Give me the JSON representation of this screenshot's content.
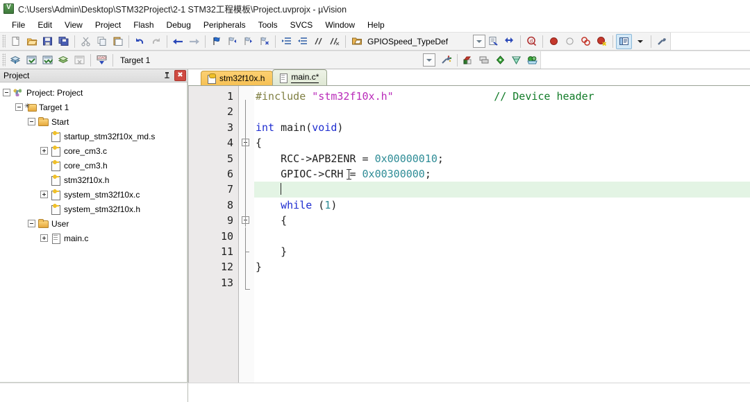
{
  "window": {
    "icon": "uvision-app-icon",
    "title": "C:\\Users\\Admin\\Desktop\\STM32Project\\2-1 STM32工程模板\\Project.uvprojx - µVision"
  },
  "menu": {
    "items": [
      {
        "label": "File"
      },
      {
        "label": "Edit"
      },
      {
        "label": "View"
      },
      {
        "label": "Project"
      },
      {
        "label": "Flash"
      },
      {
        "label": "Debug"
      },
      {
        "label": "Peripherals"
      },
      {
        "label": "Tools"
      },
      {
        "label": "SVCS"
      },
      {
        "label": "Window"
      },
      {
        "label": "Help"
      }
    ]
  },
  "toolbar_main": {
    "buttons": [
      {
        "name": "new-file-icon",
        "glyph": "⬜"
      },
      {
        "name": "open-file-icon",
        "glyph": "📂"
      },
      {
        "name": "save-icon",
        "glyph": "💾"
      },
      {
        "name": "save-all-icon",
        "glyph": "🖫"
      },
      {
        "name": "cut-icon",
        "glyph": "✀"
      },
      {
        "name": "copy-icon",
        "glyph": "⧉"
      },
      {
        "name": "paste-icon",
        "glyph": "📋"
      },
      {
        "name": "undo-icon",
        "glyph": "↶"
      },
      {
        "name": "redo-icon",
        "glyph": "↷"
      },
      {
        "name": "navigate-backward-icon",
        "glyph": "←"
      },
      {
        "name": "navigate-forward-icon",
        "glyph": "→"
      },
      {
        "name": "insert-bookmark-icon",
        "glyph": "⚑"
      },
      {
        "name": "previous-bookmark-icon",
        "glyph": "⚑"
      },
      {
        "name": "next-bookmark-icon",
        "glyph": "⚑"
      },
      {
        "name": "clear-bookmarks-icon",
        "glyph": "⚑"
      },
      {
        "name": "indent-icon",
        "glyph": "→|"
      },
      {
        "name": "outdent-icon",
        "glyph": "|←"
      },
      {
        "name": "comment-selection-icon",
        "glyph": "//"
      },
      {
        "name": "uncomment-selection-icon",
        "glyph": "//"
      },
      {
        "name": "open-project-icon",
        "glyph": "📁"
      }
    ],
    "find_combo": {
      "value": "GPIOSpeed_TypeDef",
      "placeholder": "GPIOSpeed_TypeDef"
    },
    "buttons_right": [
      {
        "name": "find-in-files-icon",
        "glyph": "🗋"
      },
      {
        "name": "goto-definition-icon",
        "glyph": "🔗"
      },
      {
        "name": "debug-session-icon",
        "glyph": "ⓘ"
      },
      {
        "name": "insert-breakpoint-icon",
        "glyph": "●"
      },
      {
        "name": "disable-breakpoint-icon",
        "glyph": "○"
      },
      {
        "name": "disable-all-breakpoints-icon",
        "glyph": "⬣"
      },
      {
        "name": "kill-all-breakpoints-icon",
        "glyph": "⬤"
      },
      {
        "name": "project-window-icon",
        "glyph": "▤"
      },
      {
        "name": "project-window-dropdown-icon",
        "glyph": "▾"
      },
      {
        "name": "configure-icon",
        "glyph": "🔧"
      }
    ]
  },
  "toolbar_build": {
    "buttons": [
      {
        "name": "translate-file-icon",
        "glyph": "◈"
      },
      {
        "name": "build-target-icon",
        "glyph": "☷"
      },
      {
        "name": "rebuild-all-icon",
        "glyph": "☸"
      },
      {
        "name": "batch-build-icon",
        "glyph": "◉"
      },
      {
        "name": "stop-build-icon",
        "glyph": "⌧"
      },
      {
        "name": "download-icon",
        "glyph": "⬇"
      }
    ],
    "target_label": "Target 1",
    "target_combo_value": "Target 1",
    "buttons_right": [
      {
        "name": "manage-project-items-icon",
        "glyph": "◰"
      },
      {
        "name": "select-software-packs-icon",
        "glyph": "❐"
      },
      {
        "name": "pack-installer-icon",
        "glyph": "◆"
      },
      {
        "name": "manage-run-time-env-icon",
        "glyph": "◇"
      },
      {
        "name": "multi-project-icon",
        "glyph": "⬢"
      }
    ]
  },
  "project_panel": {
    "caption": "Project",
    "pin_label": "⚑",
    "close_label": "✖",
    "tree": [
      {
        "label": "Project: Project",
        "indent": 0,
        "expander": "minus",
        "icon": "project-icon"
      },
      {
        "label": "Target 1",
        "indent": 1,
        "expander": "minus",
        "icon": "target-folder-icon"
      },
      {
        "label": "Start",
        "indent": 2,
        "expander": "minus",
        "icon": "folder-icon"
      },
      {
        "label": "startup_stm32f10x_md.s",
        "indent": 3,
        "expander": "none",
        "icon": "source-file-key-icon"
      },
      {
        "label": "core_cm3.c",
        "indent": 3,
        "expander": "plus",
        "icon": "source-file-key-icon"
      },
      {
        "label": "core_cm3.h",
        "indent": 3,
        "expander": "none",
        "icon": "source-file-key-icon"
      },
      {
        "label": "stm32f10x.h",
        "indent": 3,
        "expander": "none",
        "icon": "source-file-key-icon"
      },
      {
        "label": "system_stm32f10x.c",
        "indent": 3,
        "expander": "plus",
        "icon": "source-file-key-icon"
      },
      {
        "label": "system_stm32f10x.h",
        "indent": 3,
        "expander": "none",
        "icon": "source-file-key-icon"
      },
      {
        "label": "User",
        "indent": 2,
        "expander": "minus",
        "icon": "folder-icon"
      },
      {
        "label": "main.c",
        "indent": 3,
        "expander": "plus",
        "icon": "source-file-icon"
      }
    ]
  },
  "editor": {
    "tabs": [
      {
        "label": "stm32f10x.h",
        "active": false,
        "icon": "source-file-key-icon"
      },
      {
        "label": "main.c*",
        "active": true,
        "icon": "source-file-icon"
      }
    ],
    "line_numbers": [
      "1",
      "2",
      "3",
      "4",
      "5",
      "6",
      "7",
      "8",
      "9",
      "10",
      "11",
      "12",
      "13"
    ],
    "current_line": 7,
    "code_lines": [
      {
        "n": 1,
        "text": "#include \"stm32f10x.h\"                // Device header"
      },
      {
        "n": 2,
        "text": ""
      },
      {
        "n": 3,
        "text": "int main(void)"
      },
      {
        "n": 4,
        "text": "{"
      },
      {
        "n": 5,
        "text": "    RCC->APB2ENR = 0x00000010;"
      },
      {
        "n": 6,
        "text": "    GPIOC->CRH = 0x00300000;"
      },
      {
        "n": 7,
        "text": "    "
      },
      {
        "n": 8,
        "text": "    while (1)"
      },
      {
        "n": 9,
        "text": "    {"
      },
      {
        "n": 10,
        "text": ""
      },
      {
        "n": 11,
        "text": "    }"
      },
      {
        "n": 12,
        "text": "}"
      },
      {
        "n": 13,
        "text": ""
      }
    ],
    "colors": {
      "keyword": "#1f2ed0",
      "preprocessor": "#7f7f42",
      "string": "#b92ab9",
      "number": "#2e8c96",
      "comment": "#0f7a26",
      "current_line_highlight": "#e3f4e4"
    }
  }
}
